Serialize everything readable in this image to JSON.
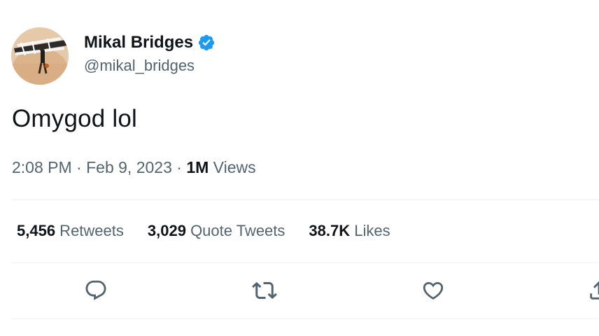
{
  "user": {
    "display_name": "Mikal Bridges",
    "handle": "@mikal_bridges",
    "verified": true,
    "verified_color": "#1d9bf0",
    "avatar_icon": "basketball-player-avatar"
  },
  "tweet": {
    "text": "Omygod lol"
  },
  "meta": {
    "time": "2:08 PM",
    "separator1": " · ",
    "date": "Feb 9, 2023",
    "separator2": " · ",
    "views_count": "1M",
    "views_label": " Views"
  },
  "stats": {
    "retweets_count": "5,456",
    "retweets_label": " Retweets",
    "quotes_count": "3,029",
    "quotes_label": " Quote Tweets",
    "likes_count": "38.7K",
    "likes_label": " Likes"
  },
  "actions": [
    {
      "icon": "reply-icon"
    },
    {
      "icon": "retweet-icon"
    },
    {
      "icon": "like-icon"
    },
    {
      "icon": "share-icon"
    }
  ],
  "colors": {
    "text_primary": "#0f1419",
    "text_secondary": "#536471",
    "divider": "#eff3f4"
  }
}
